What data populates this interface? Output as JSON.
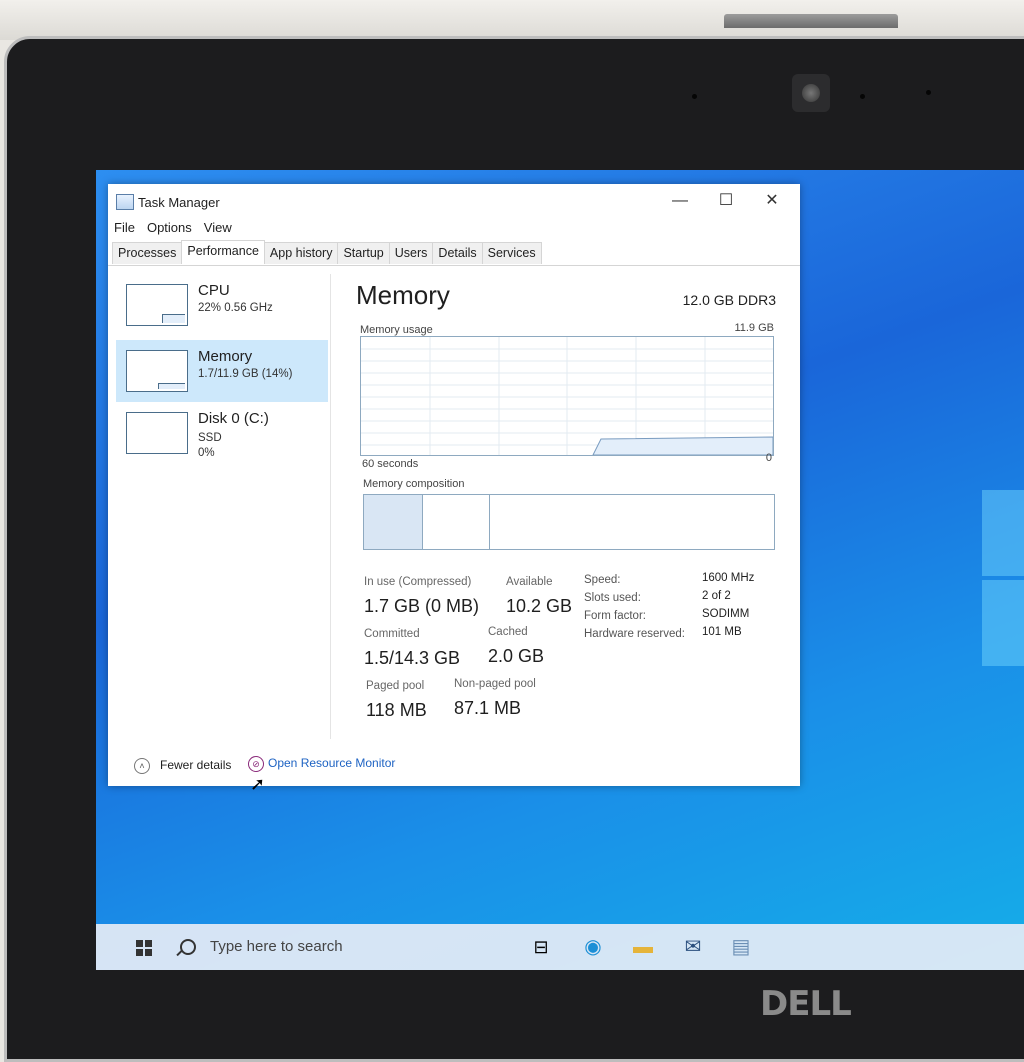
{
  "window": {
    "title": "Task Manager",
    "controls": {
      "minimize": "—",
      "maximize": "☐",
      "close": "✕"
    }
  },
  "menu": [
    "File",
    "Options",
    "View"
  ],
  "tabs": [
    "Processes",
    "Performance",
    "App history",
    "Startup",
    "Users",
    "Details",
    "Services"
  ],
  "active_tab": "Performance",
  "sidebar": {
    "items": [
      {
        "name": "CPU",
        "sub1": "22% 0.56 GHz",
        "sub2": "",
        "usage": 0.22
      },
      {
        "name": "Memory",
        "sub1": "1.7/11.9 GB (14%)",
        "sub2": "",
        "usage": 0.14
      },
      {
        "name": "Disk 0 (C:)",
        "sub1": "SSD",
        "sub2": "0%",
        "usage": 0.0
      }
    ],
    "selected_index": 1
  },
  "memory": {
    "title": "Memory",
    "type": "12.0 GB DDR3",
    "usage_label": "Memory usage",
    "usage_max": "11.9 GB",
    "time_label": "60 seconds",
    "zero_label": "0",
    "composition_label": "Memory composition",
    "stats": {
      "in_use_label": "In use (Compressed)",
      "in_use_value": "1.7 GB (0 MB)",
      "available_label": "Available",
      "available_value": "10.2 GB",
      "committed_label": "Committed",
      "committed_value": "1.5/14.3 GB",
      "cached_label": "Cached",
      "cached_value": "2.0 GB",
      "paged_label": "Paged pool",
      "paged_value": "118 MB",
      "nonpaged_label": "Non-paged pool",
      "nonpaged_value": "87.1 MB"
    },
    "details": {
      "speed_label": "Speed:",
      "speed_value": "1600 MHz",
      "slots_label": "Slots used:",
      "slots_value": "2 of 2",
      "form_label": "Form factor:",
      "form_value": "SODIMM",
      "reserved_label": "Hardware reserved:",
      "reserved_value": "101 MB"
    }
  },
  "footer": {
    "fewer_details": "Fewer details",
    "resource_monitor": "Open Resource Monitor"
  },
  "taskbar": {
    "search_placeholder": "Type here to search"
  },
  "brand": "DELL",
  "colors": {
    "accent_selected": "#cde8fb",
    "link": "#1e63c3",
    "graph_border": "#8ea9c0",
    "desktop": "#1a66d9"
  }
}
